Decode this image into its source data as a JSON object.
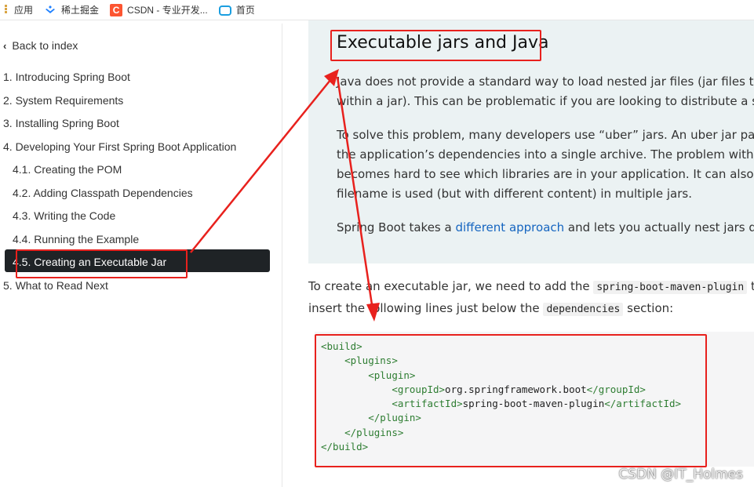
{
  "bookmarks": [
    {
      "label": "应用",
      "icon": "apps-grid-icon"
    },
    {
      "label": "稀土掘金",
      "icon": "juejin-logo-icon"
    },
    {
      "label": "CSDN - 专业开发...",
      "icon": "csdn-logo-icon"
    },
    {
      "label": "首页",
      "icon": "bilibili-tv-icon"
    }
  ],
  "sidebar": {
    "back_label": "Back to index",
    "toc": [
      {
        "label": "1. Introducing Spring Boot",
        "level": 1
      },
      {
        "label": "2. System Requirements",
        "level": 1
      },
      {
        "label": "3. Installing Spring Boot",
        "level": 1
      },
      {
        "label": "4. Developing Your First Spring Boot Application",
        "level": 1
      },
      {
        "label": "4.1. Creating the POM",
        "level": 2
      },
      {
        "label": "4.2. Adding Classpath Dependencies",
        "level": 2
      },
      {
        "label": "4.3. Writing the Code",
        "level": 2
      },
      {
        "label": "4.4. Running the Example",
        "level": 2
      },
      {
        "label": "4.5. Creating an Executable Jar",
        "level": 2,
        "active": true
      },
      {
        "label": "5. What to Read Next",
        "level": 1
      }
    ]
  },
  "content": {
    "heading": "Executable jars and Java",
    "para1": {
      "line1": "Java does not provide a standard way to load nested jar files (jar files that ar",
      "line2": "within a jar). This can be problematic if you are looking to distribute a self-co"
    },
    "para2": {
      "line1": "To solve this problem, many developers use “uber” jars. An uber jar packages",
      "line2": "the application’s dependencies into a single archive. The problem with this a",
      "line3": "becomes hard to see which libraries are in your application. It can also be pro",
      "line4": "filename is used (but with different content) in multiple jars."
    },
    "para3": {
      "before": "Spring Boot takes a ",
      "link": "different approach",
      "after": " and lets you actually nest jars directly"
    },
    "para4": {
      "line1_before": "To create an executable jar, we need to add the ",
      "line1_code": "spring-boot-maven-plugin",
      "line1_after": " to o",
      "line2_before": "insert the following lines just below the ",
      "line2_code": "dependencies",
      "line2_after": " section:"
    },
    "code": {
      "l1": "<build>",
      "l2": "<plugins>",
      "l3": "<plugin>",
      "l4_open": "<groupId>",
      "l4_val": "org.springframework.boot",
      "l4_close": "</groupId>",
      "l5_open": "<artifactId>",
      "l5_val": "spring-boot-maven-plugin",
      "l5_close": "</artifactId>",
      "l6": "</plugin>",
      "l7": "</plugins>",
      "l8": "</build>"
    }
  },
  "annotation_color": "#e8211d",
  "watermark": "CSDN @IT_Holmes"
}
